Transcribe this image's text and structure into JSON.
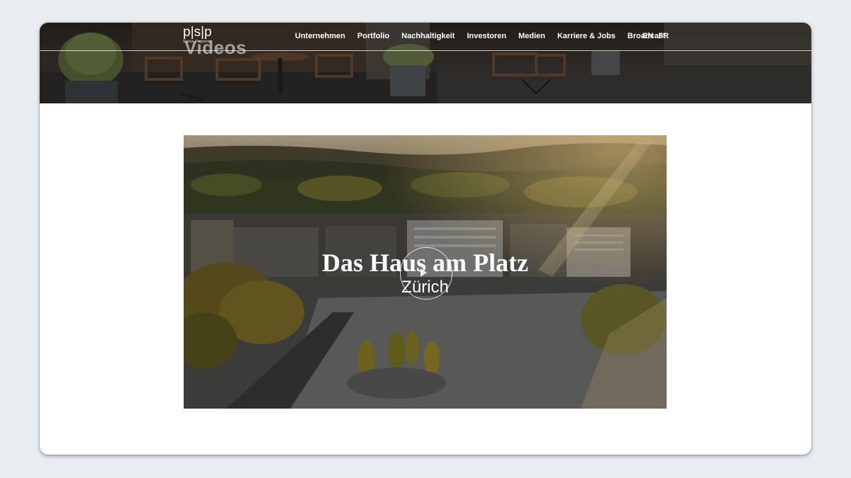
{
  "brand": {
    "logo_text": "p|s|p",
    "logo_subtitle": "Swiss Property"
  },
  "hero": {
    "title": "Videos"
  },
  "nav": {
    "items": [
      {
        "label": "Unternehmen"
      },
      {
        "label": "Portfolio"
      },
      {
        "label": "Nachhaltigkeit"
      },
      {
        "label": "Investoren"
      },
      {
        "label": "Medien"
      },
      {
        "label": "Karriere & Jobs"
      },
      {
        "label": "Broadcast"
      }
    ],
    "languages": [
      {
        "label": "EN"
      },
      {
        "label": "FR"
      }
    ]
  },
  "video": {
    "title": "Das Haus am Platz",
    "subtitle": "Zürich",
    "play_icon": "play-icon"
  },
  "colors": {
    "page_background": "#e9ecf0",
    "window_background": "#ffffff",
    "nav_text": "#ffffff"
  }
}
